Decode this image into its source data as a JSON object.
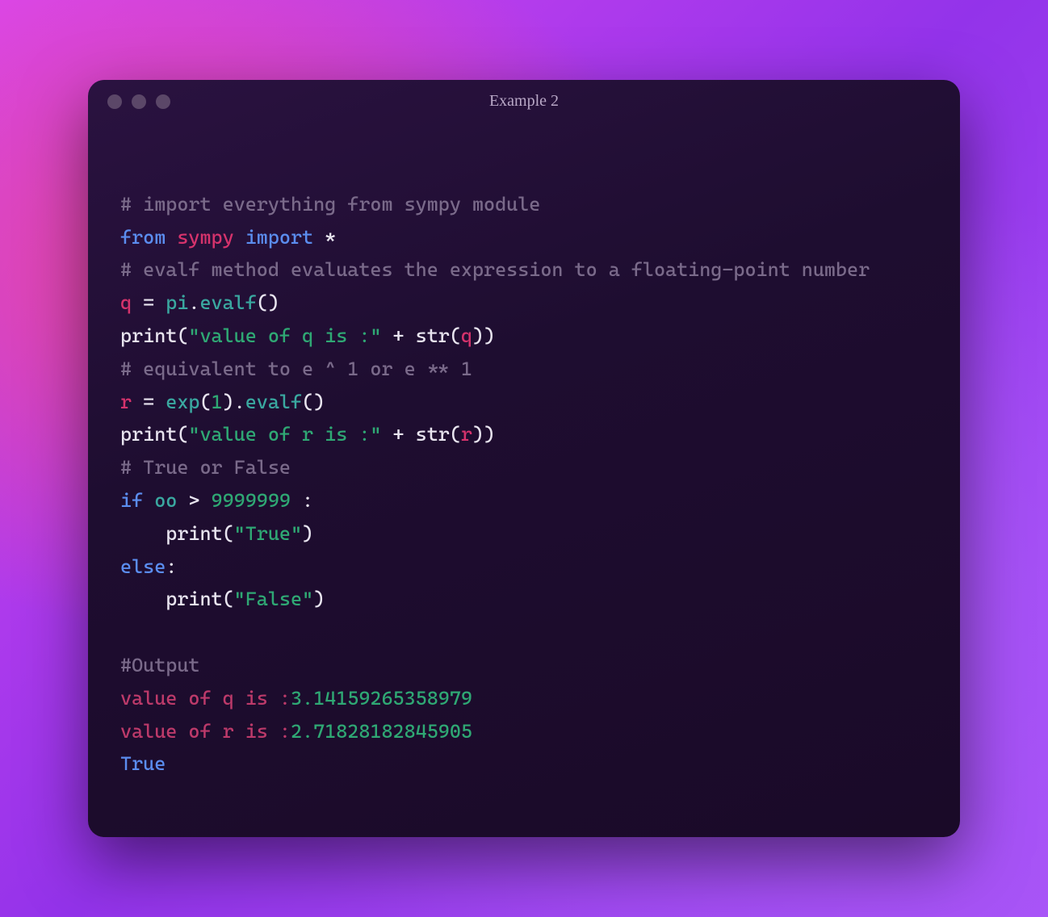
{
  "window": {
    "title": "Example 2"
  },
  "code": {
    "lines": [
      [
        {
          "cls": "c-comment",
          "text": "# import everything from sympy module"
        }
      ],
      [
        {
          "cls": "c-keyword",
          "text": "from"
        },
        {
          "cls": "c-default",
          "text": " "
        },
        {
          "cls": "c-module",
          "text": "sympy"
        },
        {
          "cls": "c-default",
          "text": " "
        },
        {
          "cls": "c-keyword",
          "text": "import"
        },
        {
          "cls": "c-default",
          "text": " *"
        }
      ],
      [
        {
          "cls": "c-comment",
          "text": "# evalf method evaluates the expression to a floating-point number"
        }
      ],
      [
        {
          "cls": "c-var",
          "text": "q"
        },
        {
          "cls": "c-default",
          "text": " = "
        },
        {
          "cls": "c-func",
          "text": "pi"
        },
        {
          "cls": "c-default",
          "text": "."
        },
        {
          "cls": "c-func",
          "text": "evalf"
        },
        {
          "cls": "c-punct",
          "text": "()"
        }
      ],
      [
        {
          "cls": "c-default",
          "text": "print("
        },
        {
          "cls": "c-string",
          "text": "\"value of q is :\""
        },
        {
          "cls": "c-default",
          "text": " + "
        },
        {
          "cls": "c-default",
          "text": "str("
        },
        {
          "cls": "c-var",
          "text": "q"
        },
        {
          "cls": "c-default",
          "text": "))"
        }
      ],
      [
        {
          "cls": "c-comment",
          "text": "# equivalent to e ^ 1 or e ** 1"
        }
      ],
      [
        {
          "cls": "c-var",
          "text": "r"
        },
        {
          "cls": "c-default",
          "text": " = "
        },
        {
          "cls": "c-func",
          "text": "exp"
        },
        {
          "cls": "c-punct",
          "text": "("
        },
        {
          "cls": "c-number",
          "text": "1"
        },
        {
          "cls": "c-punct",
          "text": ")."
        },
        {
          "cls": "c-func",
          "text": "evalf"
        },
        {
          "cls": "c-punct",
          "text": "()"
        }
      ],
      [
        {
          "cls": "c-default",
          "text": "print("
        },
        {
          "cls": "c-string",
          "text": "\"value of r is :\""
        },
        {
          "cls": "c-default",
          "text": " + "
        },
        {
          "cls": "c-default",
          "text": "str("
        },
        {
          "cls": "c-var",
          "text": "r"
        },
        {
          "cls": "c-default",
          "text": "))"
        }
      ],
      [
        {
          "cls": "c-comment",
          "text": "# True or False"
        }
      ],
      [
        {
          "cls": "c-keyword",
          "text": "if"
        },
        {
          "cls": "c-default",
          "text": " "
        },
        {
          "cls": "c-func",
          "text": "oo"
        },
        {
          "cls": "c-default",
          "text": " > "
        },
        {
          "cls": "c-number",
          "text": "9999999"
        },
        {
          "cls": "c-default",
          "text": " :"
        }
      ],
      [
        {
          "cls": "c-default",
          "text": "    print("
        },
        {
          "cls": "c-string",
          "text": "\"True\""
        },
        {
          "cls": "c-default",
          "text": ")"
        }
      ],
      [
        {
          "cls": "c-keyword",
          "text": "else"
        },
        {
          "cls": "c-default",
          "text": ":"
        }
      ],
      [
        {
          "cls": "c-default",
          "text": "    print("
        },
        {
          "cls": "c-string",
          "text": "\"False\""
        },
        {
          "cls": "c-default",
          "text": ")"
        }
      ],
      [
        {
          "cls": "c-default",
          "text": ""
        }
      ],
      [
        {
          "cls": "c-comment",
          "text": "#Output"
        }
      ],
      [
        {
          "cls": "c-outlabel",
          "text": "value of q is :"
        },
        {
          "cls": "c-outval",
          "text": "3.14159265358979"
        }
      ],
      [
        {
          "cls": "c-outlabel",
          "text": "value of r is :"
        },
        {
          "cls": "c-outval",
          "text": "2.71828182845905"
        }
      ],
      [
        {
          "cls": "c-outbool",
          "text": "True"
        }
      ]
    ]
  }
}
